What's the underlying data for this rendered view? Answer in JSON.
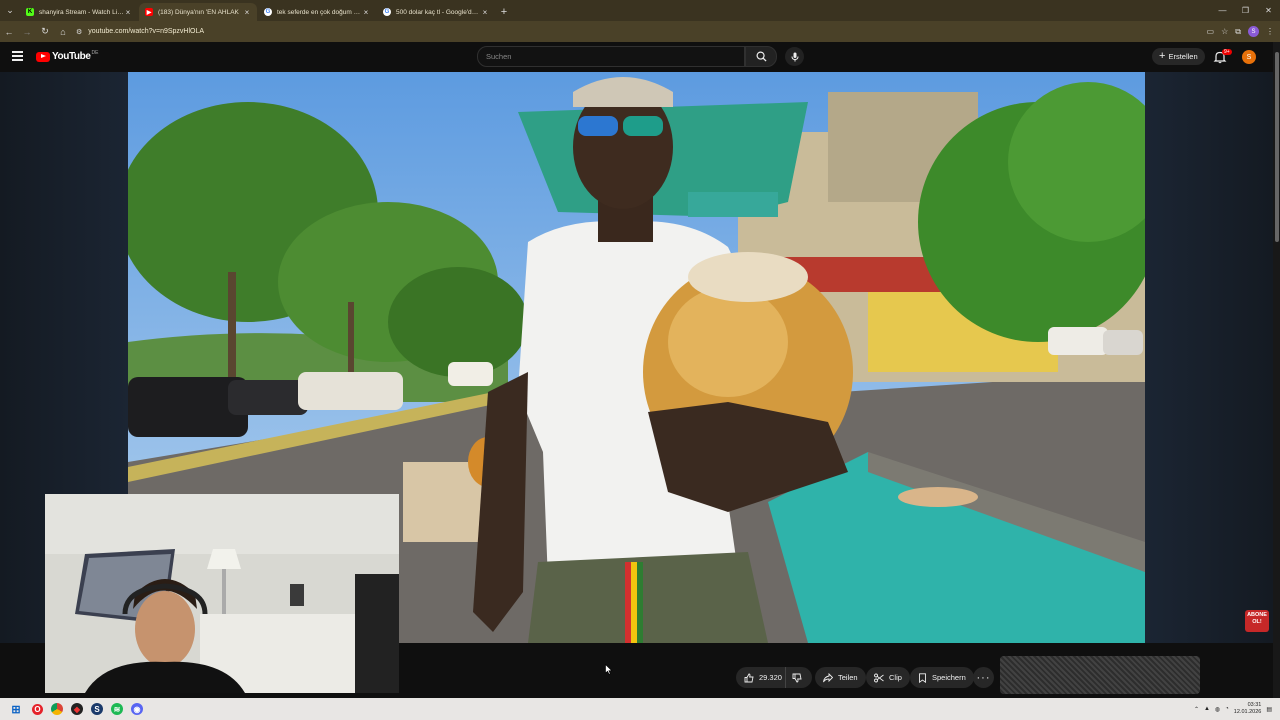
{
  "browser": {
    "tabs": [
      {
        "title": "shanyira Stream - Watch Live o",
        "favicon": "kick-icon",
        "color": "#53fc18",
        "active": false
      },
      {
        "title": "(183) Dünya'nın 'EN AHLAK",
        "favicon": "youtube-icon",
        "color": "#ff0000",
        "active": true
      },
      {
        "title": "tek seferde en çok doğum yapa",
        "favicon": "google-icon",
        "color": "#ffffff",
        "active": false
      },
      {
        "title": "500 dolar kaç tl - Google'da Ar",
        "favicon": "google-icon",
        "color": "#ffffff",
        "active": false
      }
    ],
    "new_tab": "+",
    "url": "youtube.com/watch?v=n9SpzvHlOLA",
    "profile_initial": "S"
  },
  "youtube": {
    "logo_text": "YouTube",
    "country": "DE",
    "search_placeholder": "Suchen",
    "create_label": "Erstellen",
    "notification_count": "9+",
    "avatar_initial": "S",
    "like_count": "29.320",
    "share_label": "Teilen",
    "clip_label": "Clip",
    "save_label": "Speichern",
    "more_label": "···"
  },
  "overlay": {
    "abone_line1": "ABONE",
    "abone_line2": "OL!"
  },
  "taskbar": {
    "time": "03:31",
    "date": "12.01.2026"
  },
  "colors": {
    "yt_red": "#ff0000",
    "tabbar_bg": "#3a3320",
    "addr_bg": "#4a4128",
    "page_bg": "#0f0f0f"
  }
}
